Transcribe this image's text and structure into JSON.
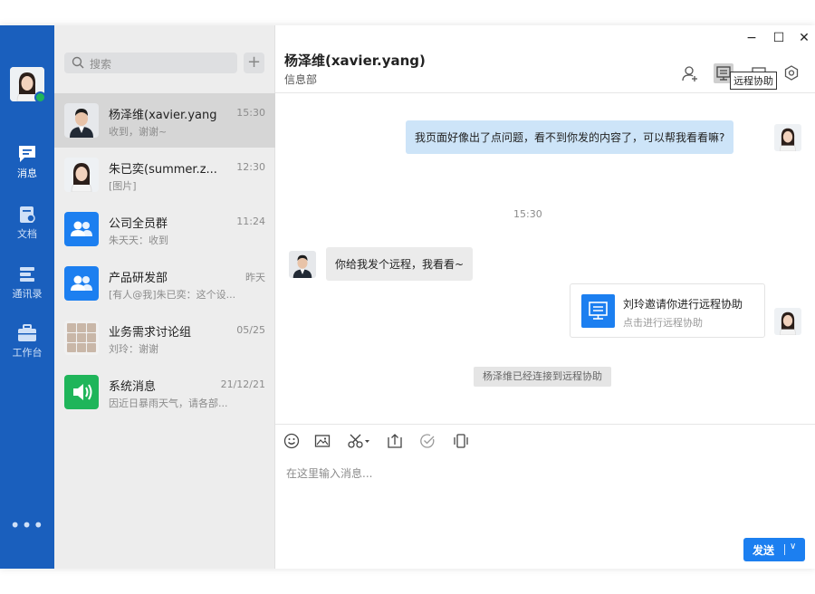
{
  "nav": {
    "items": [
      {
        "label": "消息",
        "icon": "message-icon"
      },
      {
        "label": "文档",
        "icon": "document-icon"
      },
      {
        "label": "通讯录",
        "icon": "contacts-icon"
      },
      {
        "label": "工作台",
        "icon": "workbench-icon"
      }
    ],
    "more": "•••"
  },
  "search": {
    "placeholder": "搜索",
    "add": "+"
  },
  "conversations": [
    {
      "name": "杨泽维(xavier.yang)",
      "time": "15:30",
      "preview": "收到，谢谢~"
    },
    {
      "name": "朱已奕(summer.z...",
      "time": "12:30",
      "preview": "[图片]"
    },
    {
      "name": "公司全员群",
      "time": "11:24",
      "preview": "朱天天：收到"
    },
    {
      "name": "产品研发部",
      "time": "昨天",
      "preview": "[有人@我]朱已奕：这个设..."
    },
    {
      "name": "业务需求讨论组",
      "time": "05/25",
      "preview": "刘玲：谢谢"
    },
    {
      "name": "系统消息",
      "time": "21/12/21",
      "preview": "因近日暴雨天气，请各部..."
    }
  ],
  "header": {
    "title": "杨泽维(xavier.yang)",
    "dept": "信息部",
    "tooltip": "远程协助",
    "window": {
      "minimize": "−",
      "maximize": "☐",
      "close": "✕"
    }
  },
  "messages": {
    "m1": "我页面好像出了点问题，看不到你发的内容了，可以帮我看看嘛?",
    "time": "15:30",
    "m2": "你给我发个远程，我看看~",
    "card_title": "刘玲邀请你进行远程协助",
    "card_sub": "点击进行远程协助",
    "system": "杨泽维已经连接到远程协助"
  },
  "composer": {
    "placeholder": "在这里输入消息...",
    "send": "发送",
    "dropdown": "∨"
  },
  "colors": {
    "nav": "#1a5fbd",
    "accent": "#1c7ff0",
    "bubble": "#cde4f8",
    "online": "#1fb55a"
  }
}
